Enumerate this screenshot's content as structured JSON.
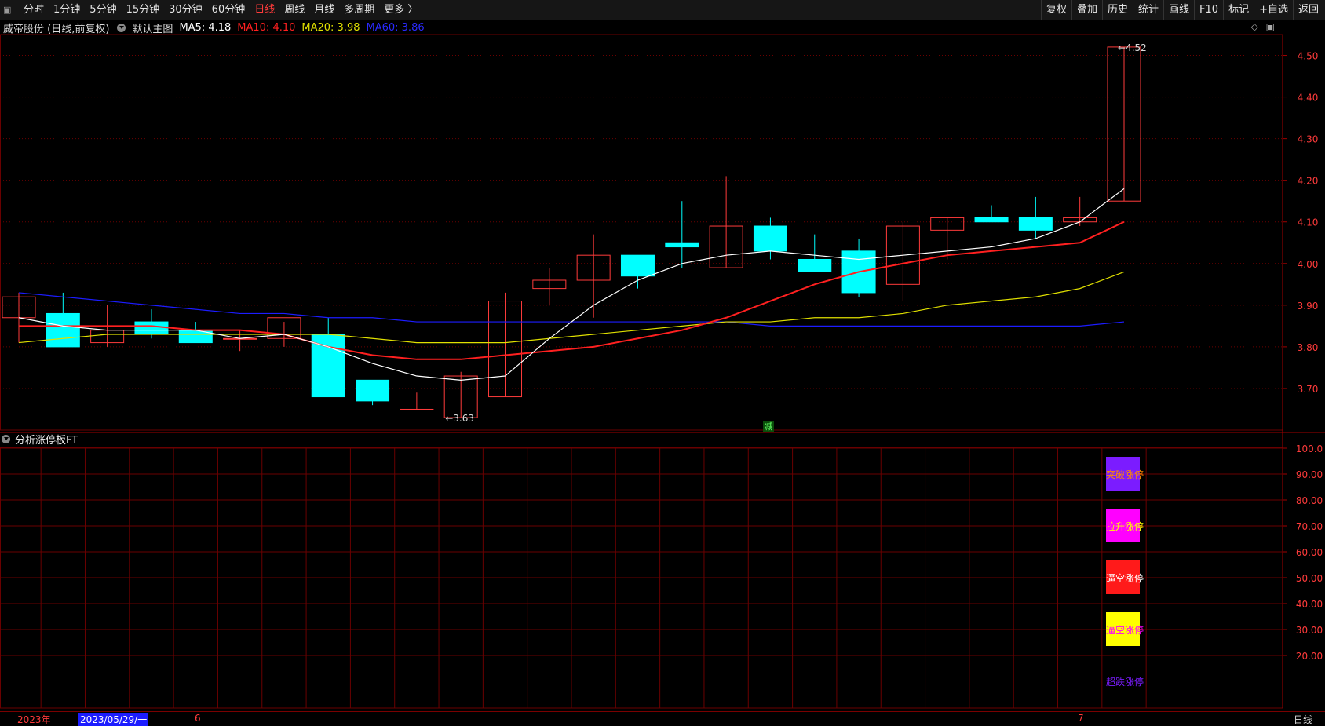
{
  "toolbar": {
    "periods": [
      "分时",
      "1分钟",
      "5分钟",
      "15分钟",
      "30分钟",
      "60分钟",
      "日线",
      "周线",
      "月线",
      "多周期",
      "更多 〉"
    ],
    "active_period": "日线",
    "right_items": [
      "复权",
      "叠加",
      "历史",
      "统计",
      "画线",
      "F10",
      "标记",
      "+自选",
      "返回"
    ]
  },
  "info": {
    "stock": "威帝股份 (日线,前复权)",
    "main_chart": "默认主图",
    "ma5": "MA5: 4.18",
    "ma10": "MA10: 4.10",
    "ma20": "MA20: 3.98",
    "ma60": "MA60: 3.86"
  },
  "panel_icons": [
    "◇",
    "▣"
  ],
  "indicator": {
    "title": "分析涨停板FT",
    "y_ticks": [
      "100.0",
      "90.00",
      "80.00",
      "70.00",
      "60.00",
      "50.00",
      "40.00",
      "30.00",
      "20.00"
    ],
    "legend": [
      {
        "label": "突破涨停",
        "box": "#7b1cff",
        "text": "#ff8c00"
      },
      {
        "label": "拉升涨停",
        "box": "#ff00ff",
        "text": "#ffff00"
      },
      {
        "label": "逼空涨停",
        "box": "#ff1a1a",
        "text": "#ffffff"
      },
      {
        "label": "逼空涨停",
        "box": "#ffff00",
        "text": "#ff00ff"
      },
      {
        "label": "超跌涨停",
        "box": null,
        "text": "#7b1cff"
      }
    ]
  },
  "bottom": {
    "year": "2023年",
    "cursor_date": "2023/05/29/一",
    "month6": "6",
    "month7": "7",
    "period": "日线"
  },
  "markers": {
    "high": "4.52",
    "low": "3.63",
    "center": "减"
  },
  "colors": {
    "up": "#ff3b3b",
    "down": "#00ffff",
    "ma5": "#ffffff",
    "ma10": "#ff2020",
    "ma20": "#e0e000",
    "ma60": "#1c1cff",
    "grid": "#6a0000"
  },
  "chart_data": {
    "type": "candlestick",
    "y_ticks": [
      3.7,
      3.8,
      3.9,
      4.0,
      4.1,
      4.2,
      4.3,
      4.4,
      4.5
    ],
    "ylim": [
      3.6,
      4.55
    ],
    "candles": [
      {
        "o": 3.87,
        "h": 3.93,
        "l": 3.81,
        "c": 3.92
      },
      {
        "o": 3.88,
        "h": 3.93,
        "l": 3.8,
        "c": 3.8
      },
      {
        "o": 3.81,
        "h": 3.9,
        "l": 3.8,
        "c": 3.84
      },
      {
        "o": 3.86,
        "h": 3.89,
        "l": 3.82,
        "c": 3.83
      },
      {
        "o": 3.84,
        "h": 3.86,
        "l": 3.81,
        "c": 3.81
      },
      {
        "o": 3.82,
        "h": 3.84,
        "l": 3.79,
        "c": 3.82
      },
      {
        "o": 3.82,
        "h": 3.86,
        "l": 3.8,
        "c": 3.87
      },
      {
        "o": 3.83,
        "h": 3.87,
        "l": 3.68,
        "c": 3.68
      },
      {
        "o": 3.72,
        "h": 3.72,
        "l": 3.66,
        "c": 3.67
      },
      {
        "o": 3.65,
        "h": 3.69,
        "l": 3.65,
        "c": 3.65
      },
      {
        "o": 3.63,
        "h": 3.74,
        "l": 3.63,
        "c": 3.73
      },
      {
        "o": 3.68,
        "h": 3.93,
        "l": 3.68,
        "c": 3.91
      },
      {
        "o": 3.94,
        "h": 3.99,
        "l": 3.9,
        "c": 3.96
      },
      {
        "o": 3.96,
        "h": 4.07,
        "l": 3.87,
        "c": 4.02
      },
      {
        "o": 4.02,
        "h": 4.02,
        "l": 3.94,
        "c": 3.97
      },
      {
        "o": 4.05,
        "h": 4.15,
        "l": 3.99,
        "c": 4.04
      },
      {
        "o": 3.99,
        "h": 4.21,
        "l": 3.99,
        "c": 4.09
      },
      {
        "o": 4.09,
        "h": 4.11,
        "l": 4.01,
        "c": 4.03
      },
      {
        "o": 4.01,
        "h": 4.07,
        "l": 3.98,
        "c": 3.98
      },
      {
        "o": 4.03,
        "h": 4.06,
        "l": 3.92,
        "c": 3.93
      },
      {
        "o": 3.95,
        "h": 4.1,
        "l": 3.91,
        "c": 4.09
      },
      {
        "o": 4.08,
        "h": 4.11,
        "l": 4.01,
        "c": 4.11
      },
      {
        "o": 4.11,
        "h": 4.14,
        "l": 4.1,
        "c": 4.1
      },
      {
        "o": 4.11,
        "h": 4.16,
        "l": 4.06,
        "c": 4.08
      },
      {
        "o": 4.1,
        "h": 4.16,
        "l": 4.09,
        "c": 4.11
      },
      {
        "o": 4.15,
        "h": 4.52,
        "l": 4.15,
        "c": 4.52
      }
    ],
    "ma5": [
      3.87,
      3.85,
      3.84,
      3.84,
      3.84,
      3.82,
      3.83,
      3.8,
      3.76,
      3.73,
      3.72,
      3.73,
      3.82,
      3.9,
      3.96,
      4.0,
      4.02,
      4.03,
      4.02,
      4.01,
      4.02,
      4.03,
      4.04,
      4.06,
      4.1,
      4.18
    ],
    "ma10": [
      3.85,
      3.85,
      3.85,
      3.85,
      3.84,
      3.84,
      3.83,
      3.8,
      3.78,
      3.77,
      3.77,
      3.78,
      3.79,
      3.8,
      3.82,
      3.84,
      3.87,
      3.91,
      3.95,
      3.98,
      4.0,
      4.02,
      4.03,
      4.04,
      4.05,
      4.1
    ],
    "ma20": [
      3.81,
      3.82,
      3.83,
      3.83,
      3.83,
      3.83,
      3.83,
      3.83,
      3.82,
      3.81,
      3.81,
      3.81,
      3.82,
      3.83,
      3.84,
      3.85,
      3.86,
      3.86,
      3.87,
      3.87,
      3.88,
      3.9,
      3.91,
      3.92,
      3.94,
      3.98
    ],
    "ma60": [
      3.93,
      3.92,
      3.91,
      3.9,
      3.89,
      3.88,
      3.88,
      3.87,
      3.87,
      3.86,
      3.86,
      3.86,
      3.86,
      3.86,
      3.86,
      3.86,
      3.86,
      3.85,
      3.85,
      3.85,
      3.85,
      3.85,
      3.85,
      3.85,
      3.85,
      3.86
    ]
  }
}
